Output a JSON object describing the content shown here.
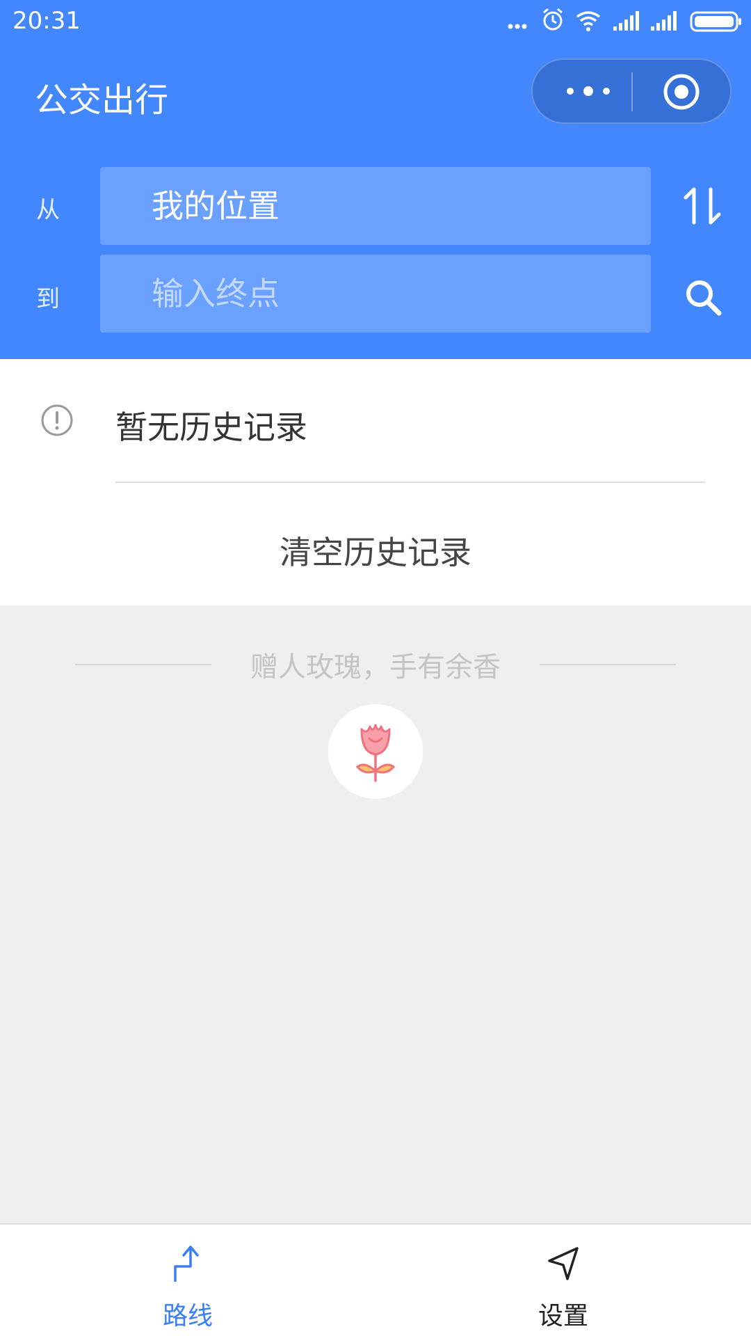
{
  "status_bar": {
    "time": "20:31"
  },
  "header": {
    "title": "公交出行",
    "from_label": "从",
    "to_label": "到",
    "from_value": "我的位置",
    "to_placeholder": "输入终点"
  },
  "history": {
    "empty_text": "暂无历史记录",
    "clear_label": "清空历史记录"
  },
  "footer": {
    "slogan": "赠人玫瑰，手有余香"
  },
  "tabbar": {
    "items": [
      {
        "label": "路线",
        "icon": "route-icon",
        "active": true
      },
      {
        "label": "设置",
        "icon": "navigation-arrow-icon",
        "active": false
      }
    ]
  },
  "colors": {
    "primary": "#4287fd",
    "field_bg": "#6aa0ff",
    "capsule_bg": "#3570d6",
    "tab_active": "#3a7ef7",
    "rose": "#f0717e"
  }
}
